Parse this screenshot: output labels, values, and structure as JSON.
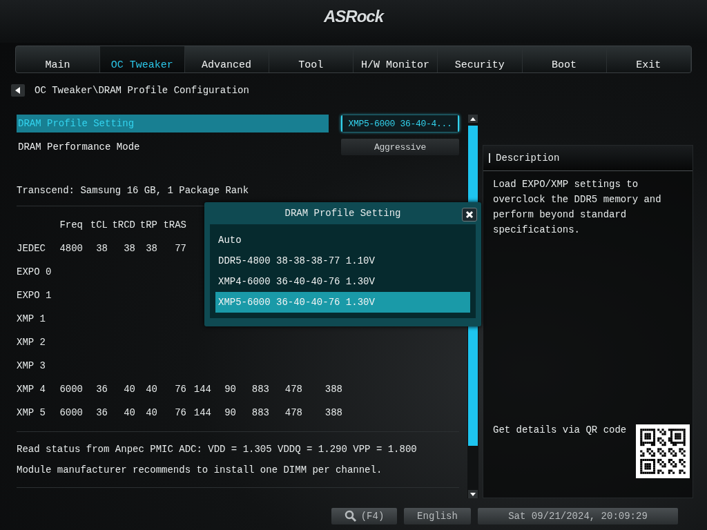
{
  "logo": "ASRock",
  "tabs": [
    {
      "label": "Main",
      "selected": false
    },
    {
      "label": "OC Tweaker",
      "selected": true
    },
    {
      "label": "Advanced",
      "selected": false
    },
    {
      "label": "Tool",
      "selected": false
    },
    {
      "label": "H/W Monitor",
      "selected": false
    },
    {
      "label": "Security",
      "selected": false
    },
    {
      "label": "Boot",
      "selected": false
    },
    {
      "label": "Exit",
      "selected": false
    }
  ],
  "breadcrumb": "OC Tweaker\\DRAM Profile Configuration",
  "settings": [
    {
      "label": "DRAM Profile Setting",
      "value": "XMP5-6000 36-40-4...",
      "selected": true
    },
    {
      "label": "DRAM Performance Mode",
      "value": "Aggressive",
      "selected": false
    }
  ],
  "module_info": "Transcend: Samsung 16 GB, 1 Package Rank",
  "profile_table": {
    "columns": [
      "Freq",
      "tCL",
      "tRCD",
      "tRP",
      "tRAS"
    ],
    "rows": [
      {
        "name": "JEDEC",
        "values": [
          "4800",
          "38",
          "38",
          "38",
          "77"
        ]
      },
      {
        "name": "EXPO 0"
      },
      {
        "name": "EXPO 1"
      },
      {
        "name": "XMP 1"
      },
      {
        "name": "XMP 2"
      },
      {
        "name": "XMP 3"
      },
      {
        "name": "XMP 4",
        "values": [
          "6000",
          "36",
          "40",
          "40",
          "76",
          "144",
          "90",
          "883",
          "478",
          "388"
        ]
      },
      {
        "name": "XMP 5",
        "values": [
          "6000",
          "36",
          "40",
          "40",
          "76",
          "144",
          "90",
          "883",
          "478",
          "388"
        ]
      }
    ]
  },
  "notes": [
    "Read status from Anpec PMIC ADC: VDD = 1.305 VDDQ = 1.290 VPP = 1.800",
    "Module manufacturer recommends to install one DIMM per channel."
  ],
  "dialog": {
    "title": "DRAM Profile Setting",
    "options": [
      {
        "label": "Auto",
        "selected": false
      },
      {
        "label": "DDR5-4800 38-38-38-77 1.10V",
        "selected": false
      },
      {
        "label": "XMP4-6000 36-40-40-76 1.30V",
        "selected": false
      },
      {
        "label": "XMP5-6000 36-40-40-76 1.30V",
        "selected": true
      }
    ]
  },
  "description": {
    "title": "Description",
    "text": "Load EXPO/XMP settings to overclock the DDR5 memory and perform beyond standard specifications.",
    "qr_caption": "Get details via QR code"
  },
  "footer": {
    "search_key": "(F4)",
    "language": "English",
    "datetime": "Sat 09/21/2024, 20:09:29"
  }
}
